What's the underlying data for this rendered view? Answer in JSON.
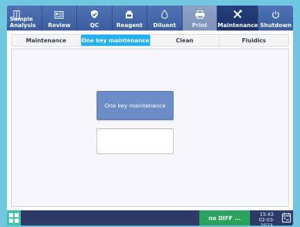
{
  "toolbar": {
    "items": [
      {
        "label": "Sample\nAnalysis",
        "icon": "sample-tube-icon",
        "state": "normal"
      },
      {
        "label": "Review",
        "icon": "review-card-icon",
        "state": "normal"
      },
      {
        "label": "QC",
        "icon": "qc-shield-icon",
        "state": "normal"
      },
      {
        "label": "Reagent",
        "icon": "reagent-bottle-icon",
        "state": "normal"
      },
      {
        "label": "Diluent",
        "icon": "diluent-drop-icon",
        "state": "normal"
      },
      {
        "label": "Print",
        "icon": "printer-icon",
        "state": "disabled"
      },
      {
        "label": "Maintenance",
        "icon": "maintenance-tools-icon",
        "state": "active"
      },
      {
        "label": "Shutdown",
        "icon": "power-icon",
        "state": "normal"
      }
    ]
  },
  "tabs": [
    {
      "label": "Maintenance",
      "active": false
    },
    {
      "label": "One key maintenance",
      "active": true
    },
    {
      "label": "Clean",
      "active": false
    },
    {
      "label": "Fluidics",
      "active": false
    }
  ],
  "main": {
    "action_button": "One key maintenance",
    "result_box": ""
  },
  "statusbar": {
    "home_icon": "apps-grid-icon",
    "status_message": "no DIFF ...",
    "time": "15:43",
    "date": "02-03-2023",
    "calendar_icon": "calendar-icon"
  },
  "colors": {
    "toolbar": "#3c5e9f",
    "active_tab": "#21b1ee",
    "status_ok": "#2ba35f",
    "home": "#3ec6a4",
    "background": "#6fc6de"
  }
}
